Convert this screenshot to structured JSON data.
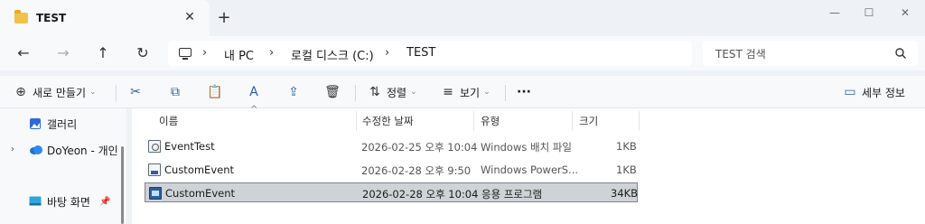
{
  "window": {
    "tab_title": "TEST",
    "tab_close": "✕",
    "tab_add": "+",
    "minimize": "—",
    "maximize": "☐",
    "close": "✕"
  },
  "nav": {
    "back": "←",
    "forward": "→",
    "up": "↑",
    "refresh": "↻"
  },
  "address": {
    "sep": "›",
    "crumbs": [
      "내 PC",
      "로컬 디스크 (C:)",
      "TEST"
    ]
  },
  "search": {
    "placeholder": "TEST 검색"
  },
  "commands": {
    "new": "새로 만들기",
    "sort": "정렬",
    "view": "보기",
    "more": "···",
    "details": "세부 정보",
    "icons": {
      "new": "⊕",
      "cut": "✂",
      "copy": "⧉",
      "paste": "📋",
      "rename": "A",
      "share": "⇪",
      "delete": "🗑",
      "sort": "⇅",
      "view": "≡",
      "details": "▭"
    }
  },
  "navpane": {
    "gallery": "갤러리",
    "onedrive": "DoYeon - 개인",
    "desktop": "바탕 화면",
    "expander": "›",
    "pin": "📌"
  },
  "table": {
    "columns": [
      "이름",
      "수정한 날짜",
      "유형",
      "크기"
    ],
    "sort_caret": "^",
    "rows": [
      {
        "name": "EventTest",
        "date": "2026-02-25 오후 10:04",
        "type": "Windows 배치 파일",
        "size": "1KB",
        "icon": "bat-icon"
      },
      {
        "name": "CustomEvent",
        "date": "2026-02-28 오후 9:50",
        "type": "Windows PowerS...",
        "size": "1KB",
        "icon": "ps1-icon"
      },
      {
        "name": "CustomEvent",
        "date": "2026-02-28 오후 10:04",
        "type": "응용 프로그램",
        "size": "34KB",
        "icon": "exe-icon",
        "selected": true
      }
    ]
  },
  "colors": {
    "accent": "#2d5fa3",
    "background": "#eef2f6",
    "selected_row": "#cfd3d8"
  }
}
